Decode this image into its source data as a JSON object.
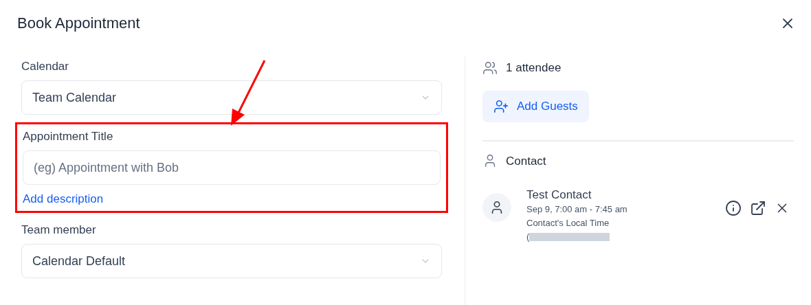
{
  "dialog": {
    "title": "Book Appointment"
  },
  "form": {
    "calendar": {
      "label": "Calendar",
      "value": "Team Calendar"
    },
    "title_field": {
      "label": "Appointment Title",
      "placeholder": "(eg) Appointment with Bob",
      "highlighted": true
    },
    "add_description": "Add description",
    "team_member": {
      "label": "Team member",
      "value": "Calendar Default"
    }
  },
  "attendees": {
    "count": "1 attendee",
    "add_button": "Add Guests"
  },
  "contact": {
    "heading": "Contact",
    "name": "Test Contact",
    "time": "Sep 9, 7:00 am - 7:45 am",
    "local_time": "Contact's Local Time",
    "redacted_prefix": "("
  }
}
